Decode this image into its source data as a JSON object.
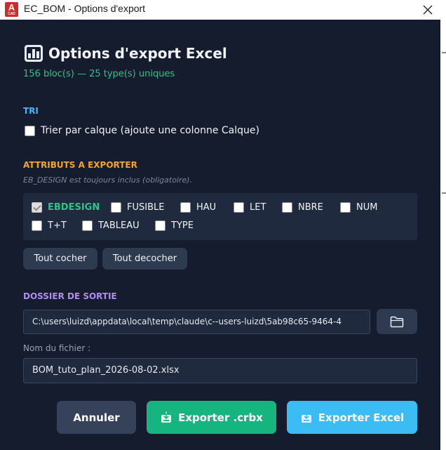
{
  "window": {
    "title": "EC_BOM - Options d'export",
    "app_icon_letter": "A",
    "app_icon_sub": "CAD"
  },
  "header": {
    "title": "Options d'export Excel",
    "subtitle": "156 bloc(s) — 25 type(s) uniques"
  },
  "tri": {
    "label": "TRI",
    "checkbox_label": "Trier par calque (ajoute une colonne Calque)",
    "checked": false
  },
  "attributes": {
    "label": "ATTRIBUTS A EXPORTER",
    "hint": "EB_DESIGN est toujours inclus (obligatoire).",
    "items": [
      {
        "label": "EBDESIGN",
        "checked": true,
        "required": true
      },
      {
        "label": "FUSIBLE",
        "checked": false
      },
      {
        "label": "HAU",
        "checked": false
      },
      {
        "label": "LET",
        "checked": false
      },
      {
        "label": "NBRE",
        "checked": false
      },
      {
        "label": "NUM",
        "checked": false
      },
      {
        "label": "T+T",
        "checked": false
      },
      {
        "label": "TABLEAU",
        "checked": false
      },
      {
        "label": "TYPE",
        "checked": false
      }
    ],
    "check_all_label": "Tout cocher",
    "uncheck_all_label": "Tout decocher"
  },
  "output": {
    "label": "DOSSIER DE SORTIE",
    "folder_path": "C:\\users\\luizd\\appdata\\local\\temp\\claude\\c--users-luizd\\5ab98c65-9464-4",
    "filename_label": "Nom du fichier :",
    "filename": "BOM_tuto_plan_2026-08-02.xlsx"
  },
  "actions": {
    "cancel_label": "Annuler",
    "export_crbx_label": "Exporter .crbx",
    "export_excel_label": "Exporter Excel"
  },
  "colors": {
    "background": "#141c2e",
    "panel": "#1f2a3e",
    "accent_green": "#2fc28a",
    "accent_blue": "#4fb4f2",
    "accent_orange": "#f3a52a",
    "accent_purple": "#b08cf5",
    "button_crbx": "#16b47e",
    "button_excel": "#3cbcf4",
    "button_cancel": "#35425a"
  }
}
